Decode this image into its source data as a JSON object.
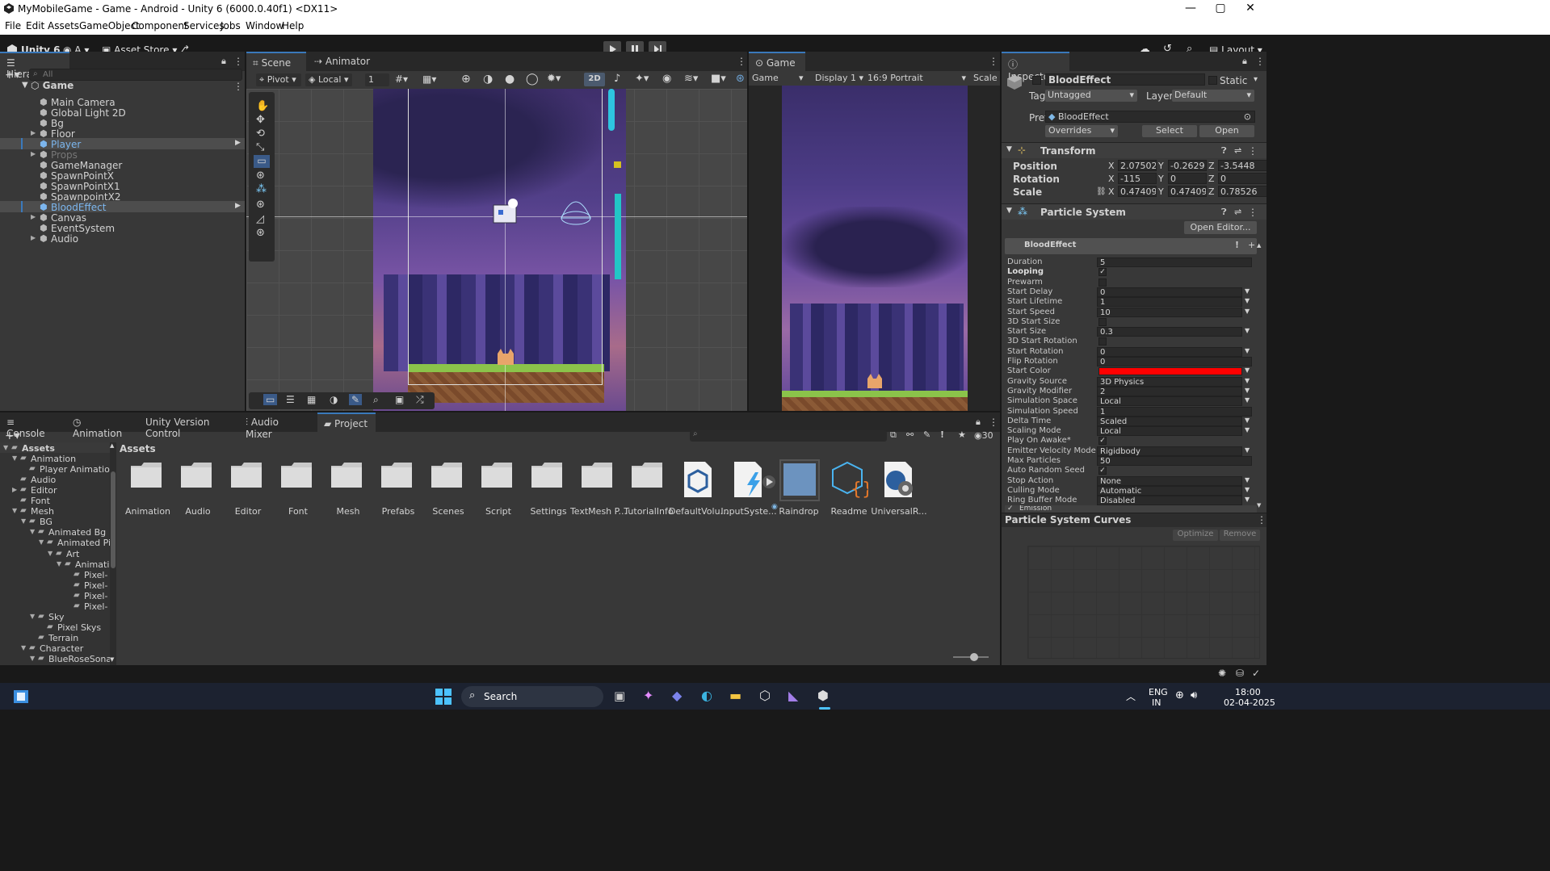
{
  "window": {
    "title": "MyMobileGame - Game - Android - Unity 6 (6000.0.40f1) <DX11>",
    "min": "—",
    "max": "▢",
    "close": "✕"
  },
  "menu": [
    "File",
    "Edit",
    "Assets",
    "GameObject",
    "Component",
    "Services",
    "Jobs",
    "Window",
    "Help"
  ],
  "toolbar": {
    "unity": "Unity 6",
    "account": "A",
    "asset_store": "Asset Store",
    "layout": "Layout"
  },
  "hierarchy": {
    "tab": "Hierarchy",
    "search_placeholder": "All",
    "scene": "Game",
    "items": [
      "Main Camera",
      "Global Light 2D",
      "Bg",
      "Floor",
      "Player",
      "Props",
      "GameManager",
      "SpawnPointX",
      "SpawnPointX1",
      "SpawnpointX2",
      "BloodEffect",
      "Canvas",
      "EventSystem",
      "Audio"
    ]
  },
  "scene": {
    "tabs": [
      "Scene",
      "Animator"
    ],
    "pivot": "Pivot",
    "local": "Local",
    "grid_num": "1",
    "mode2d": "2D"
  },
  "game": {
    "tab": "Game",
    "view": "Game",
    "display": "Display 1",
    "aspect": "16:9 Portrait",
    "scale": "Scale"
  },
  "inspector": {
    "tab": "Inspector",
    "name": "BloodEffect",
    "static": "Static",
    "tag_label": "Tag",
    "tag": "Untagged",
    "layer_label": "Layer",
    "layer": "Default",
    "prefab_label": "Prefab",
    "prefab": "BloodEffect",
    "overrides": "Overrides",
    "select": "Select",
    "open": "Open",
    "transform": {
      "title": "Transform",
      "position": {
        "label": "Position",
        "x": "2.07502",
        "y": "-0.2629",
        "z": "-3.5448"
      },
      "rotation": {
        "label": "Rotation",
        "x": "-115",
        "y": "0",
        "z": "0"
      },
      "scale": {
        "label": "Scale",
        "x": "0.47409",
        "y": "0.47409",
        "z": "0.78526"
      }
    },
    "ps": {
      "title": "Particle System",
      "open_editor": "Open Editor...",
      "name": "BloodEffect",
      "props": [
        {
          "l": "Duration",
          "v": "5",
          "t": "f"
        },
        {
          "l": "Looping",
          "v": "✓",
          "t": "c"
        },
        {
          "l": "Prewarm",
          "v": "",
          "t": "c"
        },
        {
          "l": "Start Delay",
          "v": "0",
          "t": "d"
        },
        {
          "l": "Start Lifetime",
          "v": "1",
          "t": "d"
        },
        {
          "l": "Start Speed",
          "v": "10",
          "t": "d"
        },
        {
          "l": "3D Start Size",
          "v": "",
          "t": "c"
        },
        {
          "l": "Start Size",
          "v": "0.3",
          "t": "d"
        },
        {
          "l": "3D Start Rotation",
          "v": "",
          "t": "c"
        },
        {
          "l": "Start Rotation",
          "v": "0",
          "t": "d"
        },
        {
          "l": "Flip Rotation",
          "v": "0",
          "t": "f"
        },
        {
          "l": "Start Color",
          "v": "",
          "t": "color"
        },
        {
          "l": "Gravity Source",
          "v": "3D Physics",
          "t": "d"
        },
        {
          "l": "Gravity Modifier",
          "v": "2",
          "t": "d"
        },
        {
          "l": "Simulation Space",
          "v": "Local",
          "t": "d"
        },
        {
          "l": "Simulation Speed",
          "v": "1",
          "t": "f"
        },
        {
          "l": "Delta Time",
          "v": "Scaled",
          "t": "d"
        },
        {
          "l": "Scaling Mode",
          "v": "Local",
          "t": "d"
        },
        {
          "l": "Play On Awake*",
          "v": "✓",
          "t": "c"
        },
        {
          "l": "Emitter Velocity Mode",
          "v": "Rigidbody",
          "t": "d"
        },
        {
          "l": "Max Particles",
          "v": "50",
          "t": "f"
        },
        {
          "l": "Auto Random Seed",
          "v": "✓",
          "t": "c"
        },
        {
          "l": "Stop Action",
          "v": "None",
          "t": "d"
        },
        {
          "l": "Culling Mode",
          "v": "Automatic",
          "t": "d"
        },
        {
          "l": "Ring Buffer Mode",
          "v": "Disabled",
          "t": "d"
        }
      ],
      "emission": "Emission"
    },
    "curves": {
      "title": "Particle System Curves",
      "optimize": "Optimize",
      "remove": "Remove"
    }
  },
  "bottom_tabs": [
    "Console",
    "Animation",
    "Unity Version Control",
    "Audio Mixer",
    "Project"
  ],
  "project": {
    "count": "30",
    "header": "Assets",
    "tree": [
      {
        "n": "Assets",
        "d": 0,
        "o": "▼"
      },
      {
        "n": "Animation",
        "d": 1,
        "o": "▼"
      },
      {
        "n": "Player Animation",
        "d": 2,
        "o": ""
      },
      {
        "n": "Audio",
        "d": 1,
        "o": ""
      },
      {
        "n": "Editor",
        "d": 1,
        "o": "▶"
      },
      {
        "n": "Font",
        "d": 1,
        "o": ""
      },
      {
        "n": "Mesh",
        "d": 1,
        "o": "▼"
      },
      {
        "n": "BG",
        "d": 2,
        "o": "▼"
      },
      {
        "n": "Animated Bg",
        "d": 3,
        "o": "▼"
      },
      {
        "n": "Animated Pix",
        "d": 4,
        "o": "▼"
      },
      {
        "n": "Art",
        "d": 5,
        "o": "▼"
      },
      {
        "n": "Animati",
        "d": 6,
        "o": "▼"
      },
      {
        "n": "Pixel-",
        "d": 7,
        "o": ""
      },
      {
        "n": "Pixel-",
        "d": 7,
        "o": ""
      },
      {
        "n": "Pixel-",
        "d": 7,
        "o": ""
      },
      {
        "n": "Pixel-",
        "d": 7,
        "o": ""
      },
      {
        "n": "Sky",
        "d": 3,
        "o": "▼"
      },
      {
        "n": "Pixel Skys",
        "d": 4,
        "o": ""
      },
      {
        "n": "Terrain",
        "d": 3,
        "o": ""
      },
      {
        "n": "Character",
        "d": 2,
        "o": "▼"
      },
      {
        "n": "BlueRoseSonat",
        "d": 3,
        "o": "▼"
      }
    ],
    "assets": [
      {
        "n": "Animation",
        "k": "folder"
      },
      {
        "n": "Audio",
        "k": "folder"
      },
      {
        "n": "Editor",
        "k": "folder"
      },
      {
        "n": "Font",
        "k": "folder"
      },
      {
        "n": "Mesh",
        "k": "folder"
      },
      {
        "n": "Prefabs",
        "k": "folder"
      },
      {
        "n": "Scenes",
        "k": "folder"
      },
      {
        "n": "Script",
        "k": "folder"
      },
      {
        "n": "Settings",
        "k": "folder"
      },
      {
        "n": "TextMesh P...",
        "k": "folder"
      },
      {
        "n": "TutorialInfo",
        "k": "folder"
      },
      {
        "n": "DefaultVolu...",
        "k": "volume"
      },
      {
        "n": "InputSyste...",
        "k": "input"
      },
      {
        "n": "Raindrop",
        "k": "mat"
      },
      {
        "n": "Readme",
        "k": "readme"
      },
      {
        "n": "UniversalR...",
        "k": "urp"
      }
    ]
  },
  "taskbar": {
    "search": "Search",
    "lang1": "ENG",
    "lang2": "IN",
    "time": "18:00",
    "date": "02-04-2025"
  },
  "colors": {
    "accent": "#3a79bb",
    "panel": "#383838",
    "dark": "#282828",
    "start_color": "#ff0000"
  }
}
